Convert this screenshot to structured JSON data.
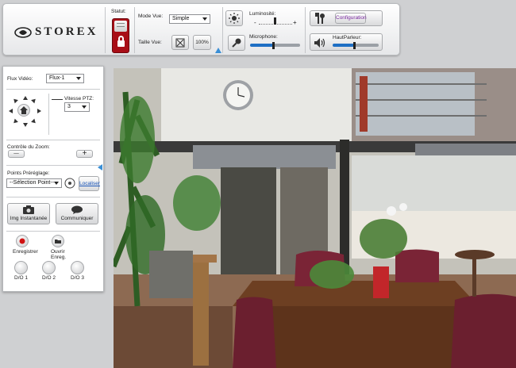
{
  "brand": {
    "name": "STOREX"
  },
  "status": {
    "label": "Statut:"
  },
  "view_mode": {
    "label": "Mode Vue:",
    "value": "Simple"
  },
  "size": {
    "label": "Taille Vue:",
    "zoom": "100%"
  },
  "brightness": {
    "label": "Luminosité:",
    "minus": "-",
    "plus": "+",
    "level": 0.5
  },
  "microphone": {
    "label": "Microphone:",
    "level": 0.45
  },
  "config": {
    "label": "Configuration"
  },
  "speaker": {
    "label": "HautParleur:",
    "level": 0.45
  },
  "sidebar": {
    "flux_label": "Flux Vidéo:",
    "flux_value": "Flux-1",
    "ptz_speed_label": "Vitesse PTZ:",
    "ptz_speed_value": "3",
    "zoom_label": "Contrôle du Zoom:",
    "zoom_minus": "—",
    "zoom_plus": "+",
    "preset_label": "Points Préréglage:",
    "preset_value": "--Sélection Point--",
    "locate_label": "Localiser",
    "snapshot_label": "Img Instantanée",
    "communicate_label": "Communiquer",
    "record_label": "Enregistrer",
    "open_record_label": "Ouvrir Enreg.",
    "do_buttons": [
      "D/O 1",
      "D/O 2",
      "D/O 3"
    ]
  },
  "colors": {
    "accent": "#1e6fc4",
    "status_red": "#a80e17",
    "config_text": "#7a2aa0"
  },
  "icons": [
    "storex-logo-icon",
    "lock-icon",
    "fullscreen-icon",
    "sun-icon",
    "microphone-icon",
    "wrench-icon",
    "speaker-icon",
    "home-icon",
    "camera-icon",
    "chat-icon",
    "record-icon",
    "folder-icon"
  ]
}
